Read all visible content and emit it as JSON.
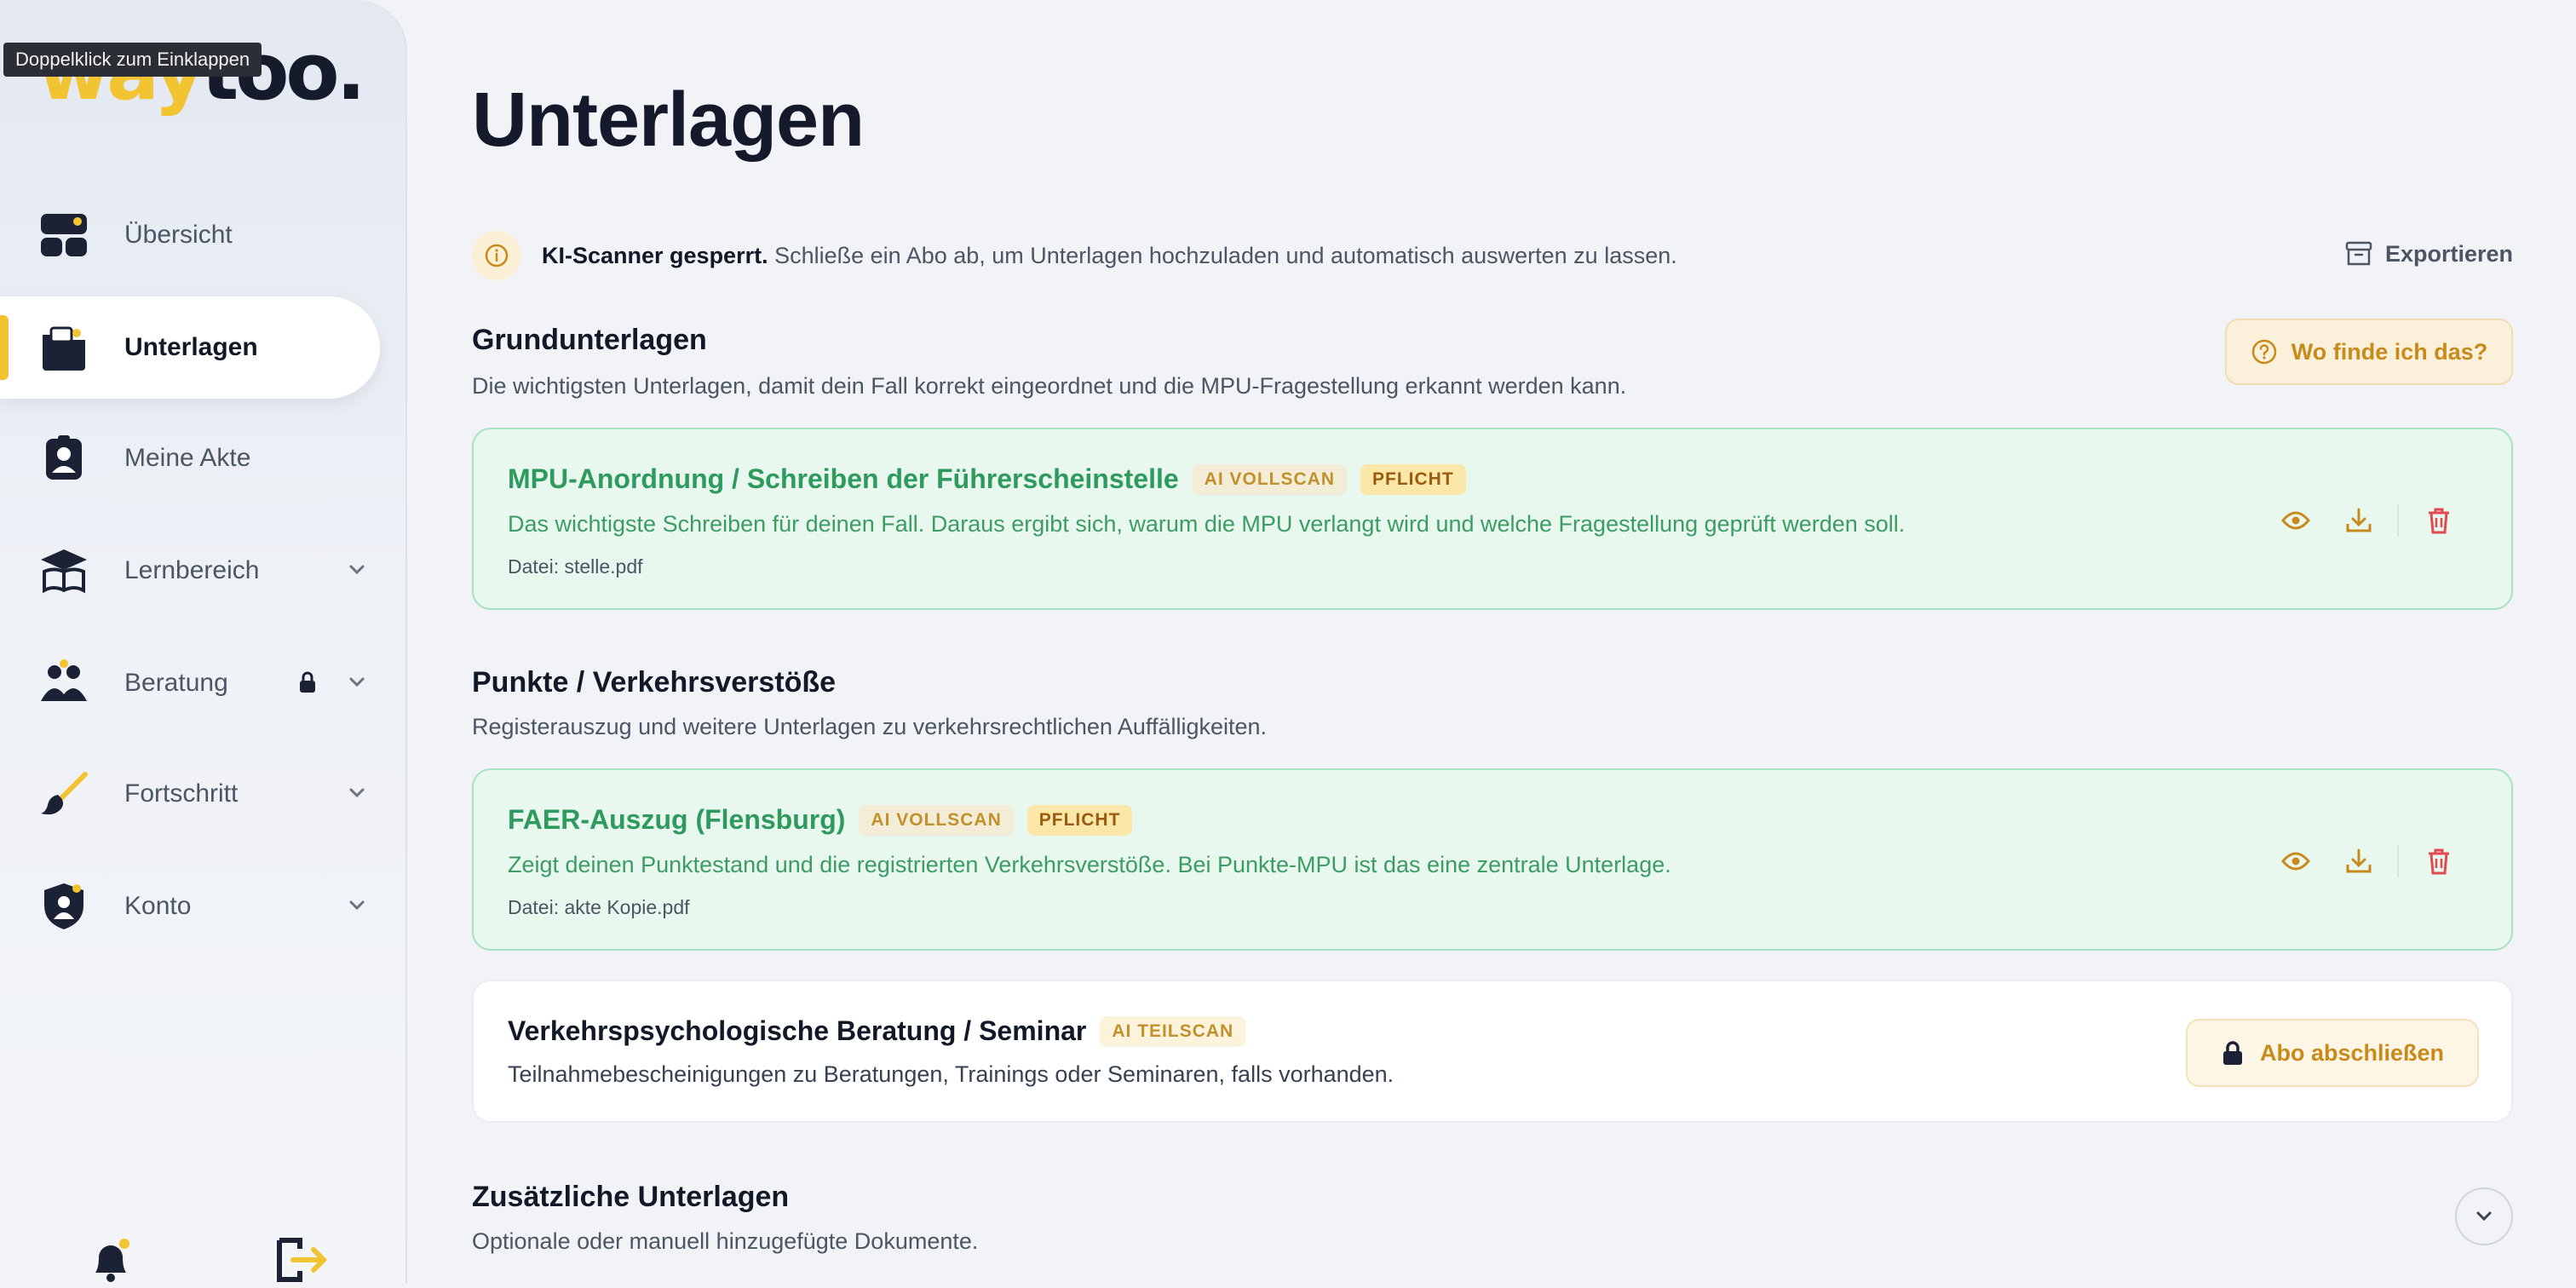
{
  "tooltip": "Doppelklick zum Einklappen",
  "logo": {
    "text_part1": "way",
    "text_part2": "too."
  },
  "sidebar": {
    "items": [
      {
        "label": "Übersicht",
        "icon": "dashboard-icon"
      },
      {
        "label": "Unterlagen",
        "icon": "folder-icon",
        "active": true
      },
      {
        "label": "Meine Akte",
        "icon": "id-badge-icon"
      },
      {
        "label": "Lernbereich",
        "icon": "graduation-book-icon",
        "expandable": true
      },
      {
        "label": "Beratung",
        "icon": "people-icon",
        "expandable": true,
        "locked": true
      },
      {
        "label": "Fortschritt",
        "icon": "brush-icon",
        "expandable": true
      },
      {
        "label": "Konto",
        "icon": "shield-user-icon",
        "expandable": true
      }
    ],
    "bottom": {
      "notifications_icon": "bell-icon",
      "logout_icon": "logout-icon"
    }
  },
  "page": {
    "title": "Unterlagen"
  },
  "notice": {
    "bold": "KI-Scanner gesperrt.",
    "text": " Schließe ein Abo ab, um Unterlagen hochzuladen und automatisch auswerten zu lassen."
  },
  "export_label": "Exportieren",
  "sections": {
    "grund": {
      "title": "Grundunterlagen",
      "subtitle": "Die wichtigsten Unterlagen, damit dein Fall korrekt eingeordnet und die MPU-Fragestellung erkannt werden kann.",
      "help_label": "Wo finde ich das?",
      "doc": {
        "title": "MPU-Anordnung / Schreiben der Führerscheinstelle",
        "tag_ai": "AI VOLLSCAN",
        "tag_required": "PFLICHT",
        "description": "Das wichtigste Schreiben für deinen Fall. Daraus ergibt sich, warum die MPU verlangt wird und welche Fragestellung geprüft werden soll.",
        "file": "Datei: stelle.pdf"
      }
    },
    "punkte": {
      "title": "Punkte / Verkehrsverstöße",
      "subtitle": "Registerauszug und weitere Unterlagen zu verkehrsrechtlichen Auffälligkeiten.",
      "doc": {
        "title": "FAER-Auszug (Flensburg)",
        "tag_ai": "AI VOLLSCAN",
        "tag_required": "PFLICHT",
        "description": "Zeigt deinen Punktestand und die registrierten Verkehrsverstöße. Bei Punkte-MPU ist das eine zentrale Unterlage.",
        "file": "Datei: akte Kopie.pdf"
      },
      "locked_doc": {
        "title": "Verkehrspsychologische Beratung / Seminar",
        "tag_ai": "AI TEILSCAN",
        "description": "Teilnahmebescheinigungen zu Beratungen, Trainings oder Seminaren, falls vorhanden.",
        "button": "Abo abschließen"
      }
    },
    "zusatz": {
      "title": "Zusätzliche Unterlagen",
      "subtitle": "Optionale oder manuell hinzugefügte Dokumente."
    }
  },
  "colors": {
    "accent": "#f3c431",
    "success": "#2f9a5d",
    "danger": "#e5484d",
    "warning_text": "#c98a1c"
  }
}
